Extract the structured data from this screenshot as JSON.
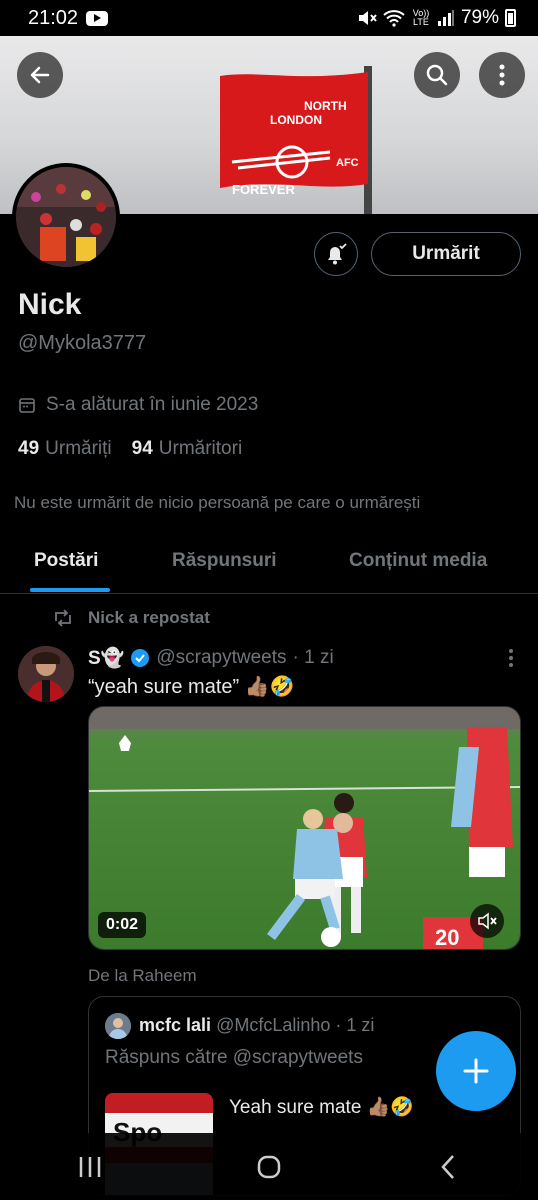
{
  "status_bar": {
    "time": "21:02",
    "battery": "79%",
    "icons": [
      "youtube-icon",
      "mute-icon",
      "wifi-icon",
      "volte-icon",
      "signal-icon",
      "battery-icon"
    ],
    "volte_label": "Vo)) LTE"
  },
  "banner": {
    "flag_text_top": "NORTH",
    "flag_text_mid": "LONDON",
    "flag_text_bottom": "FOREVER",
    "flag_badge": "AFC",
    "flag_color": "#d7191c"
  },
  "header_buttons": [
    "back-arrow-icon",
    "search-icon",
    "more-vertical-icon"
  ],
  "profile": {
    "follow_button": "Urmărit",
    "name": "Nick",
    "handle": "@Mykola3777",
    "joined": "S-a alăturat în iunie 2023",
    "following_count": "49",
    "following_label": "Urmăriți",
    "followers_count": "94",
    "followers_label": "Urmăritori",
    "not_followed_note": "Nu este urmărit de nicio persoană pe care o urmărești"
  },
  "tabs": [
    {
      "label": "Postări",
      "active": true
    },
    {
      "label": "Răspunsuri",
      "active": false
    },
    {
      "label": "Conținut media",
      "active": false
    }
  ],
  "post": {
    "repost_label": "Nick a repostat",
    "author_name": "S👻",
    "author_handle": "@scrapytweets",
    "time": "· 1 zi",
    "text": "“yeah sure mate” 👍🏽🤣",
    "video_duration": "0:02",
    "from_label": "De la Raheem",
    "quote": {
      "author_name": "mcfc lali",
      "author_handle": "@McfcLalinho",
      "time": "· 1 zi",
      "reply_to": "Răspuns către @scrapytweets",
      "text": "Yeah sure mate 👍🏽🤣"
    }
  },
  "accent_color": "#1d9bf0",
  "nav": [
    "recents-icon",
    "home-icon",
    "back-icon"
  ]
}
